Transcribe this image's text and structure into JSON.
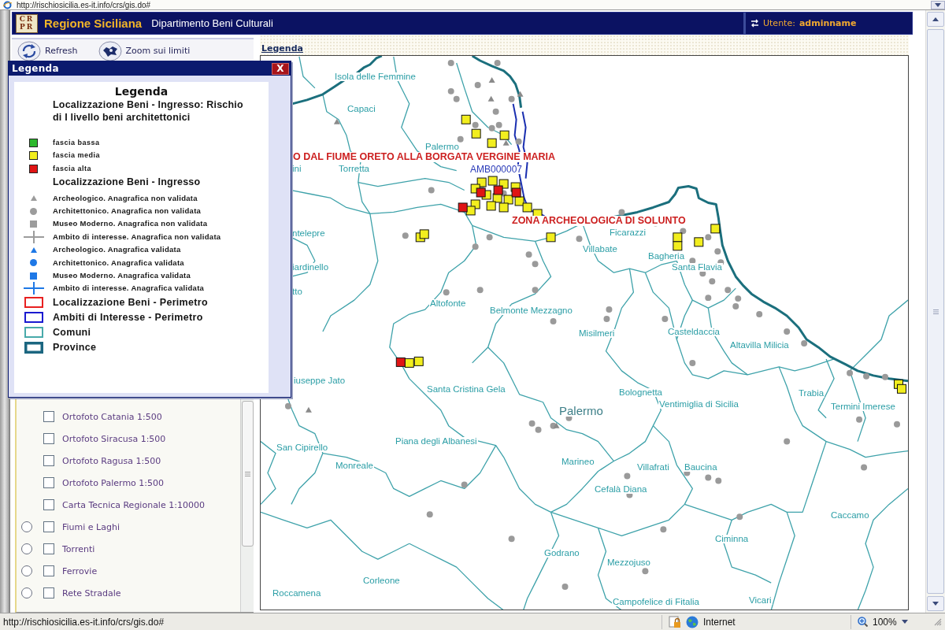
{
  "browser": {
    "address": "http://rischiosicilia.es-it.info/crs/gis.do#"
  },
  "header": {
    "logo": [
      "CR",
      "PR"
    ],
    "title": "Regione Siciliana",
    "subtitle": "Dipartimento Beni Culturali",
    "user_label": "Utente:",
    "user_name": "adminname"
  },
  "toolbar": [
    {
      "kind": "refresh",
      "label": "Refresh"
    },
    {
      "kind": "zoom",
      "label": "Zoom sui limiti"
    }
  ],
  "layers": {
    "base": [
      {
        "label": "Ortofoto Catania 1:500",
        "checked": false
      },
      {
        "label": "Ortofoto Siracusa 1:500",
        "checked": false
      },
      {
        "label": "Ortofoto Ragusa 1:500",
        "checked": false
      },
      {
        "label": "Ortofoto Palermo 1:500",
        "checked": false
      },
      {
        "label": "Carta Tecnica Regionale 1:10000",
        "checked": false
      }
    ],
    "overlays": [
      {
        "label": "Fiumi e Laghi",
        "checked": false,
        "selected": false
      },
      {
        "label": "Torrenti",
        "checked": false,
        "selected": false
      },
      {
        "label": "Ferrovie",
        "checked": false,
        "selected": false
      },
      {
        "label": "Rete Stradale",
        "checked": false,
        "selected": false
      }
    ]
  },
  "map": {
    "legend_link": "Legenda",
    "labels": [
      {
        "kind": "comune",
        "text": "Isola delle Femmine"
      },
      {
        "kind": "comune",
        "text": "Capaci"
      },
      {
        "kind": "comune",
        "text": "Palermo"
      },
      {
        "kind": "site",
        "text": "O DAL FIUME ORETO ALLA BORGATA VERGINE MARIA"
      },
      {
        "kind": "comune",
        "text": "ini"
      },
      {
        "kind": "comune",
        "text": "Torretta"
      },
      {
        "kind": "ambito",
        "text": "AMB000007"
      },
      {
        "kind": "site",
        "text": "ZONA ARCHEOLOGICA DI SOLUNTO"
      },
      {
        "kind": "comune",
        "text": "ntelepre"
      },
      {
        "kind": "comune",
        "text": "Ficarazzi"
      },
      {
        "kind": "comune",
        "text": "Villabate"
      },
      {
        "kind": "comune",
        "text": "Bagheria"
      },
      {
        "kind": "comune",
        "text": "Santa Flavia"
      },
      {
        "kind": "comune",
        "text": "iardinello"
      },
      {
        "kind": "comune",
        "text": "tto"
      },
      {
        "kind": "comune",
        "text": "Altofonte"
      },
      {
        "kind": "comune",
        "text": "Belmonte Mezzagno"
      },
      {
        "kind": "comune",
        "text": "Misilmeri"
      },
      {
        "kind": "comune",
        "text": "Casteldaccia"
      },
      {
        "kind": "comune",
        "text": "Altavilla Milicia"
      },
      {
        "kind": "comune",
        "text": "iuseppe Jato"
      },
      {
        "kind": "comune",
        "text": "Santa Cristina Gela"
      },
      {
        "kind": "comune",
        "text": "Bolognetta"
      },
      {
        "kind": "city",
        "text": "Palermo"
      },
      {
        "kind": "comune",
        "text": "Ventimiglia di Sicilia"
      },
      {
        "kind": "comune",
        "text": "Trabia"
      },
      {
        "kind": "comune",
        "text": "Termini Imerese"
      },
      {
        "kind": "comune",
        "text": "San Cipirello"
      },
      {
        "kind": "comune",
        "text": "Piana degli Albanesi"
      },
      {
        "kind": "comune",
        "text": "Monreale"
      },
      {
        "kind": "comune",
        "text": "Marineo"
      },
      {
        "kind": "comune",
        "text": "Villafrati"
      },
      {
        "kind": "comune",
        "text": "Baucina"
      },
      {
        "kind": "comune",
        "text": "Cefalà Diana"
      },
      {
        "kind": "comune",
        "text": "Caccamo"
      },
      {
        "kind": "comune",
        "text": "Ciminna"
      },
      {
        "kind": "comune",
        "text": "Godrano"
      },
      {
        "kind": "comune",
        "text": "Mezzojuso"
      },
      {
        "kind": "comune",
        "text": "Corleone"
      },
      {
        "kind": "comune",
        "text": "Roccamena"
      },
      {
        "kind": "comune",
        "text": "Campofelice di Fitalia"
      },
      {
        "kind": "comune",
        "text": "Vicari"
      }
    ]
  },
  "legend_window": {
    "title": "Legenda",
    "close": "X",
    "heading": "Legenda",
    "items": [
      {
        "kind": "title",
        "label": "Localizzazione Beni - Ingresso: Rischio di I livello beni architettonici"
      },
      {
        "kind": "fill",
        "label": "fascia bassa",
        "color": "#2db82d"
      },
      {
        "kind": "fill",
        "label": "fascia media",
        "color": "#f2ee1e"
      },
      {
        "kind": "fill",
        "label": "fascia alta",
        "color": "#e01414"
      },
      {
        "kind": "title",
        "label": "Localizzazione Beni - Ingresso"
      },
      {
        "kind": "triangle",
        "label": "Archeologico. Anagrafica non validata",
        "color": "#9c9c9c"
      },
      {
        "kind": "circle",
        "label": "Architettonico. Anagrafica non validata",
        "color": "#9c9c9c"
      },
      {
        "kind": "square",
        "label": "Museo Moderno. Anagrafica non validata",
        "color": "#9c9c9c"
      },
      {
        "kind": "cross",
        "label": "Ambito di interesse. Anagrafica non validata",
        "color": "#9c9c9c"
      },
      {
        "kind": "triangle",
        "label": "Archeologico. Anagrafica validata",
        "color": "#1e78e6"
      },
      {
        "kind": "circle",
        "label": "Architettonico. Anagrafica validata",
        "color": "#1e78e6"
      },
      {
        "kind": "square",
        "label": "Museo Moderno. Anagrafica validata",
        "color": "#1e78e6"
      },
      {
        "kind": "cross",
        "label": "Ambito di interesse. Anagrafica validata",
        "color": "#1e78e6"
      },
      {
        "kind": "outline",
        "label": "Localizzazione Beni - Perimetro",
        "color": "#e82020"
      },
      {
        "kind": "outline",
        "label": "Ambiti di Interesse - Perimetro",
        "color": "#1a1ad0"
      },
      {
        "kind": "outline",
        "label": "Comuni",
        "color": "#48aaaa"
      },
      {
        "kind": "border",
        "label": "Province",
        "color": "#1b6680"
      }
    ]
  },
  "status_bar": {
    "url": "http://rischiosicilia.es-it.info/crs/gis.do#",
    "zone": "Internet",
    "zoom": "100%"
  }
}
